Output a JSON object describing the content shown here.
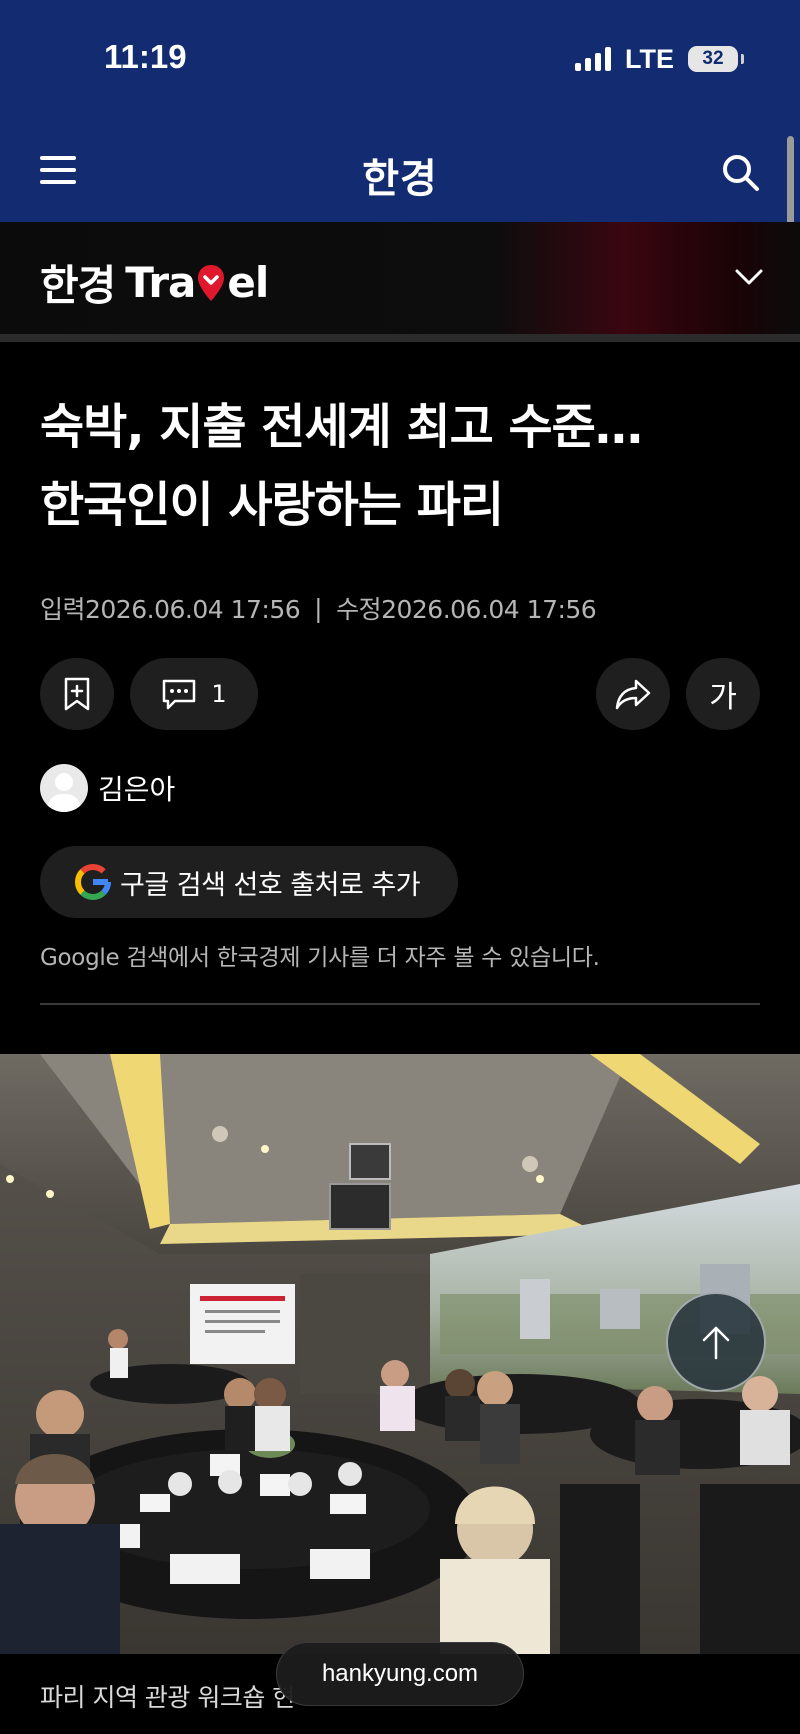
{
  "status_bar": {
    "time": "11:19",
    "network": "LTE",
    "battery": "32"
  },
  "header": {
    "logo": "한경"
  },
  "section": {
    "logo_ko": "한경",
    "logo_en_left": "Tra",
    "logo_en_right": "el"
  },
  "article": {
    "headline_line1": "숙박, 지출 전세계 최고 수준…",
    "headline_line2": "한국인이 사랑하는 파리",
    "published": "입력2026.06.04 17:56",
    "separator": "|",
    "modified": "수정2026.06.04 17:56",
    "comment_count": "1",
    "font_button": "가",
    "author": "김은아",
    "google_button": "구글 검색 선호 출처로 추가",
    "google_note": "Google 검색에서 한국경제 기사를 더 자주 볼 수 있습니다.",
    "caption": "파리 지역 관광 워크숍 현"
  },
  "browser": {
    "url": "hankyung.com"
  },
  "colors": {
    "header_bg": "#132b70",
    "page_bg": "#000000",
    "accent_red": "#e0182d"
  }
}
